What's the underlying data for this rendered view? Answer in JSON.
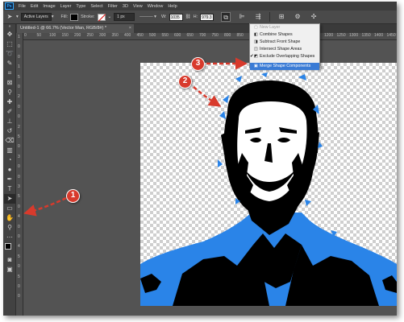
{
  "app": {
    "logo": "Ps"
  },
  "menu": [
    "File",
    "Edit",
    "Image",
    "Layer",
    "Type",
    "Select",
    "Filter",
    "3D",
    "View",
    "Window",
    "Help"
  ],
  "options": {
    "layer_mode": "Active Layers",
    "fill_label": "Fill:",
    "stroke_label": "Stroke:",
    "stroke_width": "1 px",
    "w_label": "W:",
    "w_value": "1035",
    "h_label": "H:",
    "h_value": "979.3"
  },
  "document_tab": {
    "title": "Untitled-1 @ 66.7% (Vector Man, RGB/8#) *",
    "close": "×"
  },
  "ruler_top": [
    "0",
    "50",
    "100",
    "150",
    "200",
    "250",
    "300",
    "350",
    "400",
    "450",
    "500",
    "550",
    "600",
    "650",
    "700",
    "750",
    "800",
    "850",
    "900",
    "950",
    "1000",
    "1050",
    "1100",
    "1150",
    "1200",
    "1250",
    "1300",
    "1350",
    "1400",
    "1450",
    "1500"
  ],
  "ruler_left": [
    "1",
    "0",
    "0",
    "1",
    "5",
    "0",
    "2",
    "0",
    "0",
    "2",
    "5",
    "0",
    "3",
    "0",
    "0",
    "3",
    "5",
    "0",
    "4",
    "0",
    "0",
    "4",
    "5",
    "0",
    "5",
    "0",
    "0"
  ],
  "path_ops_menu": {
    "items": [
      {
        "label": "New Layer",
        "state": "disabled",
        "icon": "new-layer-icon"
      },
      {
        "label": "Combine Shapes",
        "state": "normal",
        "icon": "combine-shapes-icon"
      },
      {
        "label": "Subtract Front Shape",
        "state": "normal",
        "icon": "subtract-front-icon"
      },
      {
        "label": "Intersect Shape Areas",
        "state": "normal",
        "icon": "intersect-icon"
      },
      {
        "label": "Exclude Overlapping Shapes",
        "state": "checked",
        "icon": "exclude-icon"
      },
      {
        "label": "Merge Shape Components",
        "state": "highlighted",
        "icon": "merge-icon"
      }
    ]
  },
  "annotations": {
    "step1": "1",
    "step2": "2",
    "step3": "3"
  },
  "colors": {
    "annotation_red": "#d83a2c",
    "shape_blue": "#2a84e8",
    "menu_highlight": "#3a7bd5"
  }
}
